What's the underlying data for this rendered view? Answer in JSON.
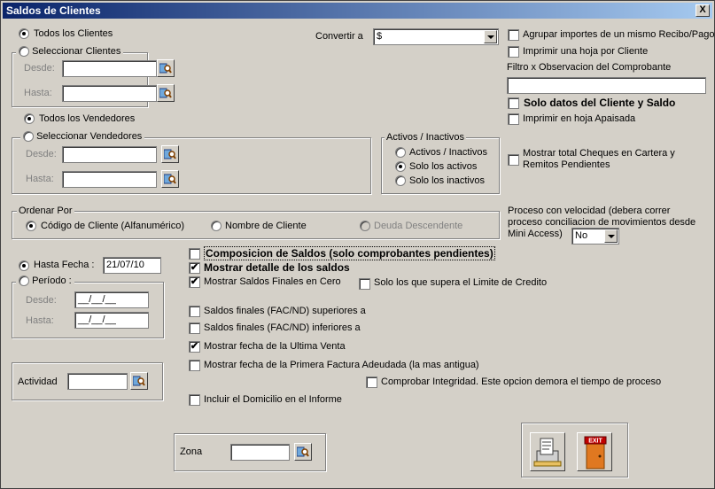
{
  "window": {
    "title": "Saldos de Clientes",
    "close_label": "X"
  },
  "clientes": {
    "todos": "Todos los Clientes",
    "seleccionar": "Seleccionar Clientes",
    "desde": "Desde:",
    "hasta": "Hasta:"
  },
  "convertir": {
    "label": "Convertir a",
    "value": "$"
  },
  "vendedores": {
    "todos": "Todos los Vendedores",
    "seleccionar": "Seleccionar Vendedores",
    "desde": "Desde:",
    "hasta": "Hasta:"
  },
  "activos": {
    "title": "Activos / Inactivos",
    "options": [
      "Activos / Inactivos",
      "Solo los activos",
      "Solo los inactivos"
    ]
  },
  "right": {
    "agrupar": "Agrupar importes de un mismo Recibo/Pago",
    "imprimir_hoja": "Imprimir una hoja por Cliente",
    "filtro_label": "Filtro x Observacion del Comprobante",
    "filtro_value": "",
    "solo_datos": "Solo datos del Cliente y Saldo",
    "apaisada": "Imprimir en hoja Apaisada",
    "cheques": "Mostrar total Cheques en Cartera y",
    "cheques2": "Remitos Pendientes",
    "proceso1": "Proceso con velocidad (debera correr",
    "proceso2": "proceso conciliacion de movimientos desde",
    "proceso3": "Mini Access)",
    "proceso_value": "No"
  },
  "ordenar": {
    "title": "Ordenar Por",
    "codigo": "Código de Cliente (Alfanumérico)",
    "nombre": "Nombre de Cliente",
    "deuda": "Deuda Descendente"
  },
  "fecha": {
    "hasta_label": "Hasta Fecha :",
    "hasta_value": "21/07/10",
    "periodo": "Período :",
    "desde": "Desde:",
    "hasta": "Hasta:",
    "desde_value": "__/__/__",
    "hasta_value2": "__/__/__"
  },
  "options": {
    "composicion": "Composicion de Saldos (solo comprobantes pendientes)",
    "detalle": "Mostrar detalle de los saldos",
    "finales_cero": "Mostrar Saldos Finales en Cero",
    "supera": "Solo los que supera el Limite de Credito",
    "superiores": "Saldos finales (FAC/ND) superiores a",
    "inferiores": "Saldos finales (FAC/ND) inferiores a",
    "ultima_venta": "Mostrar fecha de la Ultima Venta",
    "primera_factura": "Mostrar fecha de la Primera Factura Adeudada (la mas antigua)",
    "integridad": "Comprobar Integridad. Este opcion demora el tiempo de proceso",
    "domicilio": "Incluir el Domicilio en el Informe"
  },
  "actividad": {
    "label": "Actividad"
  },
  "zona": {
    "label": "Zona"
  },
  "buttons": {
    "exit_text": "EXIT"
  }
}
